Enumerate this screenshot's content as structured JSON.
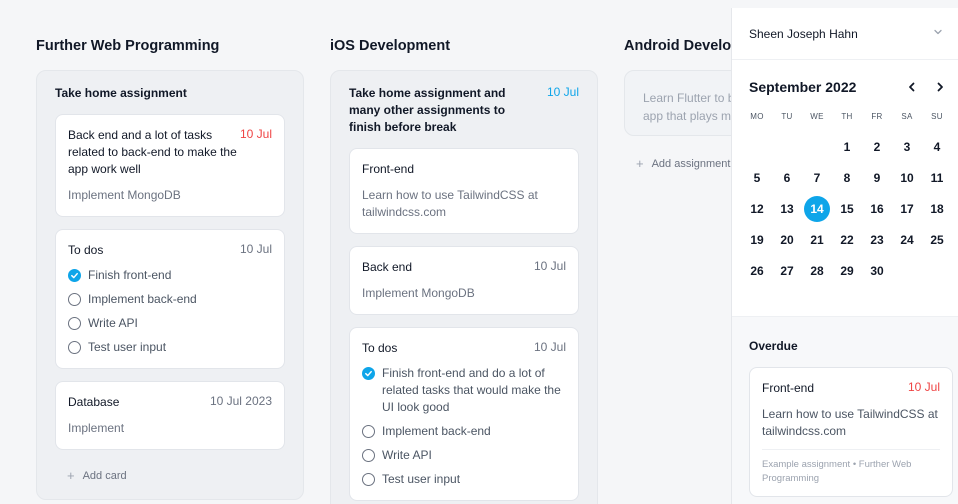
{
  "columns": [
    {
      "title": "Further Web Programming",
      "panel_title": "Take home assignment",
      "cards": [
        {
          "title": "Back end and a lot of tasks related to back-end to make the app work well",
          "date": "10 Jul",
          "body": "Implement MongoDB"
        },
        {
          "title": "To dos",
          "date": "10 Jul",
          "todos": [
            {
              "label": "Finish front-end",
              "done": true
            },
            {
              "label": "Implement back-end",
              "done": false
            },
            {
              "label": "Write API",
              "done": false
            },
            {
              "label": "Test user input",
              "done": false
            }
          ]
        },
        {
          "title": "Database",
          "date": "10 Jul 2023",
          "body": "Implement"
        }
      ],
      "add_label": "Add card"
    },
    {
      "title": "iOS Development",
      "panel_title": "Take home assignment and many other assignments to finish before break",
      "panel_date": "10 Jul",
      "cards": [
        {
          "title": "Front-end",
          "body": "Learn how to use TailwindCSS at tailwindcss.com"
        },
        {
          "title": "Back end",
          "date": "10 Jul",
          "body": "Implement MongoDB"
        },
        {
          "title": "To dos",
          "date": "10 Jul",
          "todos": [
            {
              "label": "Finish front-end and do a lot of related tasks that would make the UI look good",
              "done": true
            },
            {
              "label": "Implement back-end",
              "done": false
            },
            {
              "label": "Write API",
              "done": false
            },
            {
              "label": "Test user input",
              "done": false
            }
          ]
        }
      ]
    },
    {
      "title": "Android Development",
      "ghost_text": "Learn Flutter to build an app that plays music",
      "add_label": "Add assignment"
    }
  ],
  "sidebar": {
    "user_name": "Sheen Joseph Hahn",
    "calendar": {
      "month_label": "September 2022",
      "weekdays": [
        "MO",
        "TU",
        "WE",
        "TH",
        "FR",
        "SA",
        "SU"
      ],
      "days": [
        "",
        "",
        "",
        "1",
        "2",
        "3",
        "4",
        "5",
        "6",
        "7",
        "8",
        "9",
        "10",
        "11",
        "12",
        "13",
        "14",
        "15",
        "16",
        "17",
        "18",
        "19",
        "20",
        "21",
        "22",
        "23",
        "24",
        "25",
        "26",
        "27",
        "28",
        "29",
        "30"
      ],
      "selected_day": "14",
      "prev_icon": "chevron-left-icon",
      "next_icon": "chevron-right-icon"
    },
    "overdue": {
      "title": "Overdue",
      "card": {
        "title": "Front-end",
        "date": "10 Jul",
        "body": "Learn how to use TailwindCSS at tailwindcss.com",
        "meta": "Example assignment • Further Web Programming"
      }
    }
  },
  "colors": {
    "accent": "#0ea5e9",
    "danger": "#ef4444",
    "background": "#f5f6f8"
  }
}
